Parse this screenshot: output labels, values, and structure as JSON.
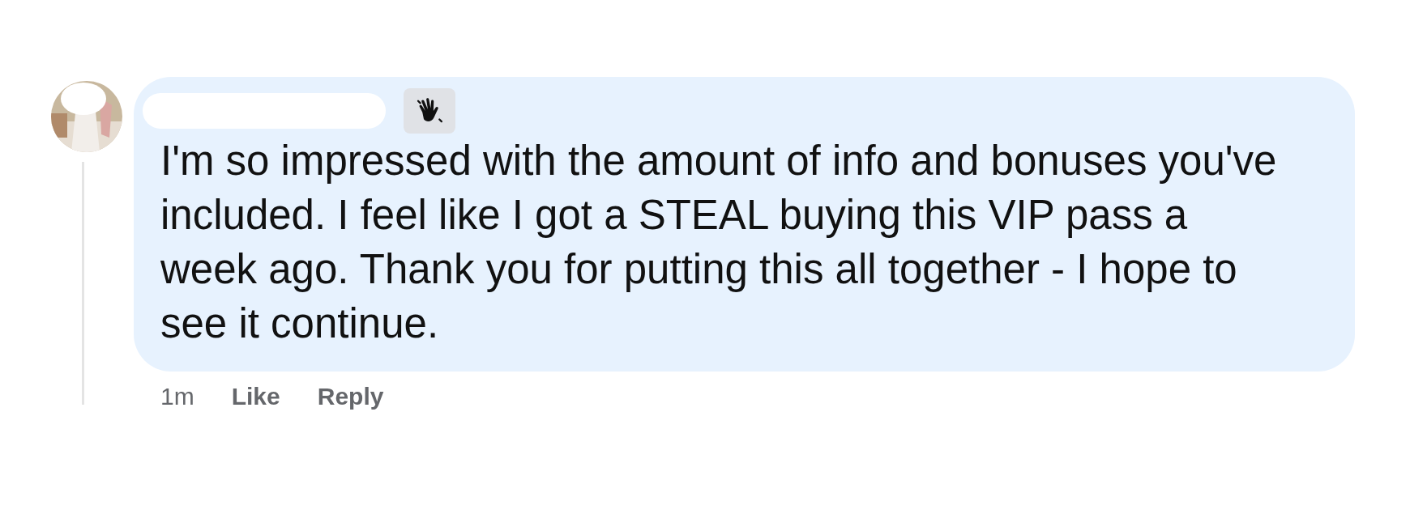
{
  "comment": {
    "author_hidden": true,
    "badge": {
      "kind": "wave"
    },
    "text": "I'm so impressed with the amount of info and bonuses you've included. I feel like I got a STEAL buying this VIP pass a week ago. Thank you for putting this all together - I hope to see it continue.",
    "time": "1m",
    "actions": [
      "Like",
      "Reply"
    ]
  }
}
